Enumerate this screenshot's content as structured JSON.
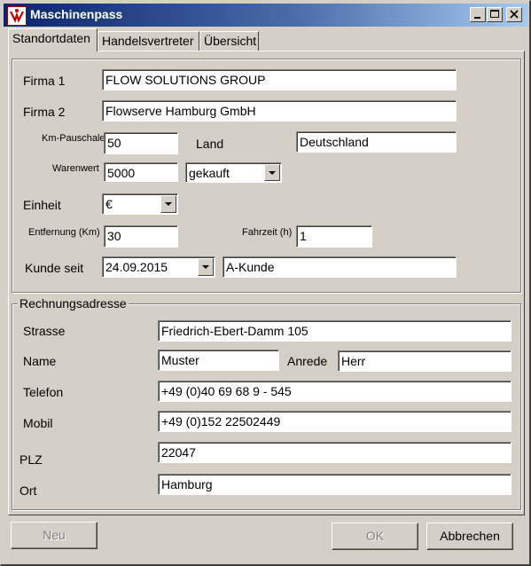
{
  "window": {
    "title": "Maschinenpass"
  },
  "tabs": [
    "Standortdaten",
    "Handelsvertreter",
    "Übersicht"
  ],
  "standort": {
    "firma1_label": "Firma 1",
    "firma1": "FLOW SOLUTIONS GROUP",
    "firma2_label": "Firma 2",
    "firma2": "Flowserve Hamburg GmbH",
    "km_label": "Km-Pauschale",
    "km": "50",
    "land_label": "Land",
    "land": "Deutschland",
    "warenwert_label": "Warenwert",
    "warenwert": "5000",
    "status": "gekauft",
    "einheit_label": "Einheit",
    "einheit": "€",
    "entfernung_label": "Entfernung (Km)",
    "entfernung": "30",
    "fahrzeit_label": "Fahrzeit (h)",
    "fahrzeit": "1",
    "kunde_seit_label": "Kunde seit",
    "kunde_seit": "24.09.2015",
    "kunde_typ": "A-Kunde"
  },
  "rechnung": {
    "legend": "Rechnungsadresse",
    "strasse_label": "Strasse",
    "strasse": "Friedrich-Ebert-Damm 105",
    "name_label": "Name",
    "name": "Muster",
    "anrede_label": "Anrede",
    "anrede": "Herr",
    "telefon_label": "Telefon",
    "telefon": "+49 (0)40 69 68 9 - 545",
    "mobil_label": "Mobil",
    "mobil": "+49 (0)152 22502449",
    "plz_label": "PLZ",
    "plz": "22047",
    "ort_label": "Ort",
    "ort": "Hamburg"
  },
  "buttons": {
    "neu": "Neu",
    "ok": "OK",
    "abbrechen": "Abbrechen"
  }
}
